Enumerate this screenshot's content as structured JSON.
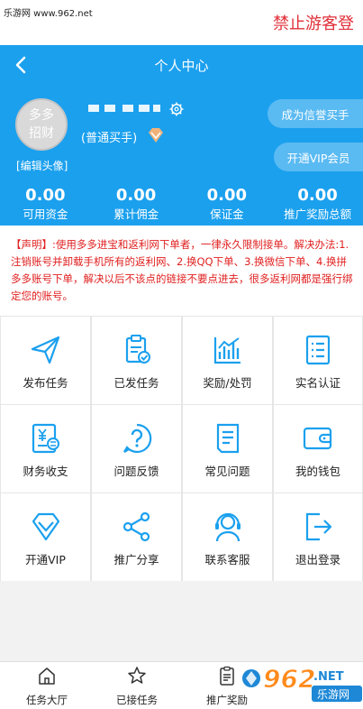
{
  "watermark": {
    "site": "乐游网 www.962.net",
    "banner": "禁止游客登",
    "logo_number": "962",
    "logo_tld": ".NET",
    "logo_name": "乐游网"
  },
  "header": {
    "title": "个人中心"
  },
  "profile": {
    "avatar_text": "多多招财",
    "user_type": "(普通买手)",
    "edit_avatar": "[编辑头像]",
    "credit_button": "成为信誉买手",
    "vip_button": "开通VIP会员"
  },
  "stats": [
    {
      "value": "0.00",
      "label": "可用资金"
    },
    {
      "value": "0.00",
      "label": "累计佣金"
    },
    {
      "value": "0.00",
      "label": "保证金"
    },
    {
      "value": "0.00",
      "label": "推广奖励总额"
    }
  ],
  "notice": "【声明】:使用多多进宝和返利网下单者，一律永久限制接单。解决办法:1.注销账号并卸载手机所有的返利网、2.换QQ下单、3.换微信下单、4.换拼多多账号下单，解决以后不该点的链接不要点进去，很多返利网都是强行绑定您的账号。",
  "menu": [
    {
      "label": "发布任务",
      "icon": "paper-plane-icon"
    },
    {
      "label": "已发任务",
      "icon": "clipboard-check-icon"
    },
    {
      "label": "奖励/处罚",
      "icon": "chart-icon"
    },
    {
      "label": "实名认证",
      "icon": "list-doc-icon"
    },
    {
      "label": "财务收支",
      "icon": "finance-doc-icon"
    },
    {
      "label": "问题反馈",
      "icon": "question-icon"
    },
    {
      "label": "常见问题",
      "icon": "document-icon"
    },
    {
      "label": "我的钱包",
      "icon": "wallet-icon"
    },
    {
      "label": "开通VIP",
      "icon": "diamond-icon"
    },
    {
      "label": "推广分享",
      "icon": "share-icon"
    },
    {
      "label": "联系客服",
      "icon": "headset-icon"
    },
    {
      "label": "退出登录",
      "icon": "logout-icon"
    }
  ],
  "tabs": [
    {
      "label": "任务大厅",
      "icon": "home-icon"
    },
    {
      "label": "已接任务",
      "icon": "star-icon"
    },
    {
      "label": "推广奖励",
      "icon": "clipboard-icon"
    }
  ],
  "colors": {
    "primary": "#1ba0ee",
    "notice": "#e02020",
    "icon": "#1ba0ee"
  }
}
